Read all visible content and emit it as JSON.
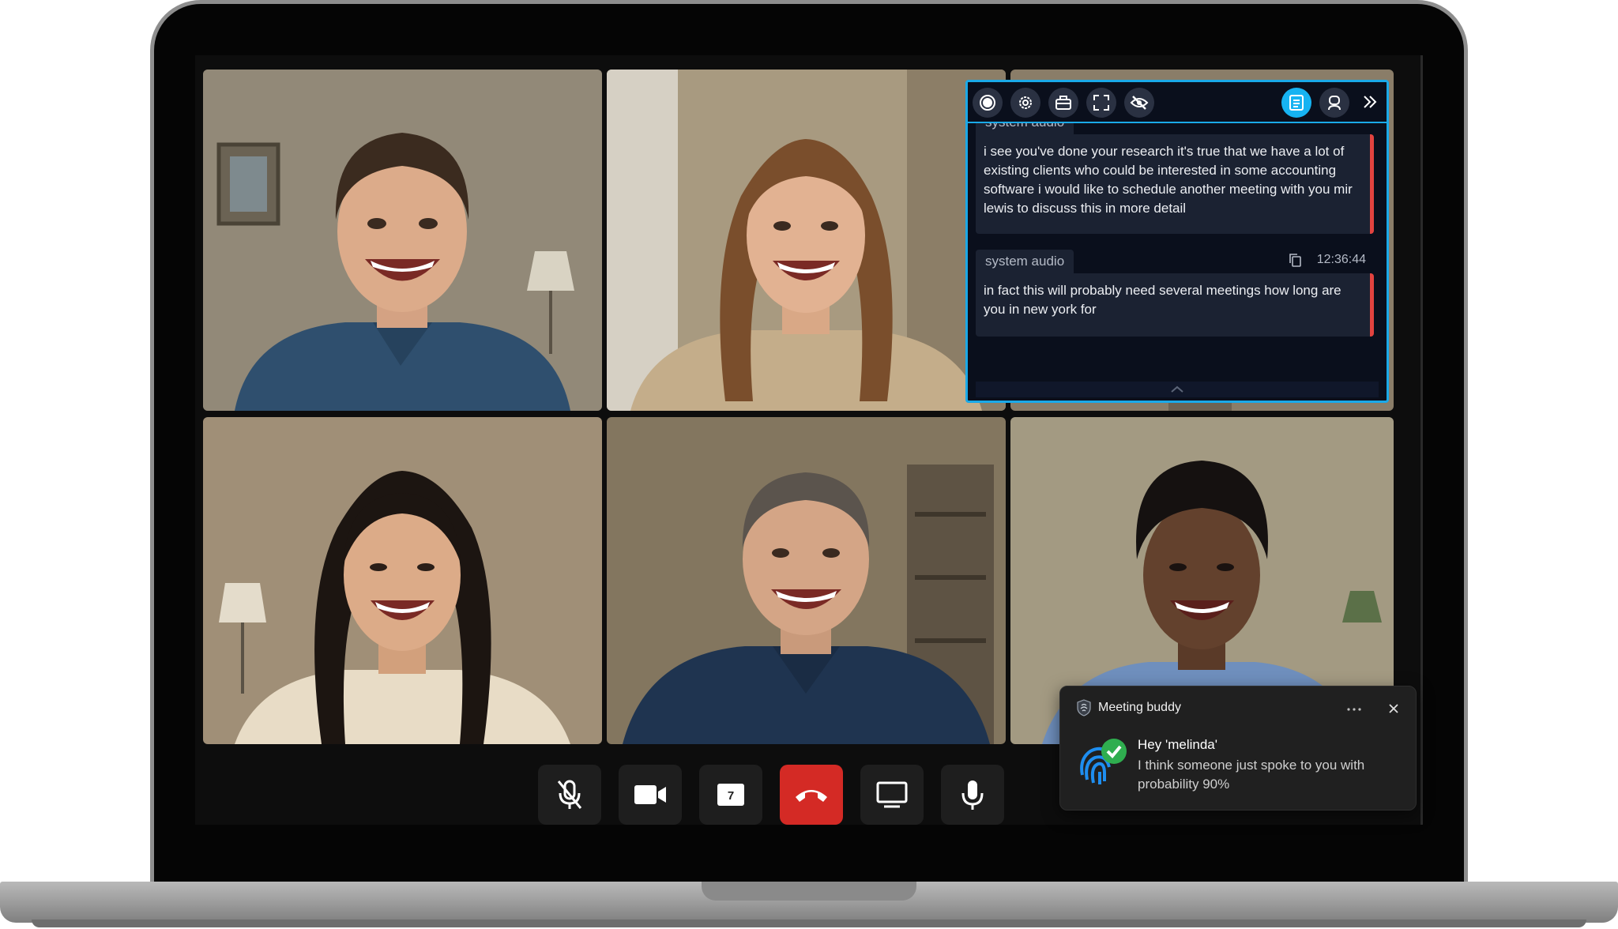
{
  "transcript": {
    "toolbar": {
      "icons": [
        "record-icon",
        "gear-icon",
        "briefcase-icon",
        "fullscreen-icon",
        "eye-off-icon",
        "transcript-list-icon",
        "assistant-icon",
        "chevron-double-right-icon"
      ],
      "active_icon": "transcript-list-icon"
    },
    "entries": [
      {
        "source": "system audio",
        "text": "i see you've done your research it's true that we have a lot of existing clients who could be interested in some accounting software i would like to schedule another meeting with you mir lewis to discuss this in more detail"
      },
      {
        "source": "system audio",
        "timestamp": "12:36:44",
        "text": "in fact this will probably need several meetings how long are you in new york for"
      }
    ],
    "accent_color": "#1aa9e8",
    "marker_color": "#e2433f"
  },
  "notification": {
    "app_name": "Meeting buddy",
    "title": "Hey 'melinda'",
    "body": "I think someone just spoke to you with probability 90%"
  },
  "call_controls": {
    "buttons": [
      "mic-off-icon",
      "camera-icon",
      "calendar-icon",
      "end-call-icon",
      "screen-share-icon",
      "mic-icon"
    ],
    "calendar_day": "7",
    "end_call_color": "#d42a25"
  }
}
